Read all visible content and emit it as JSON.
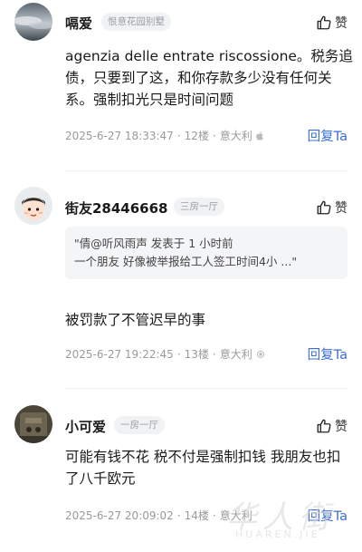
{
  "comments": [
    {
      "username": "嗝爱",
      "tag": "恨意花园别墅",
      "like_label": "赞",
      "text": "agenzia delle entrate riscossione。税务追债，只要到了这，和你存款多少没有任何关系。强制扣光只是时间问题",
      "date": "2025-6-27 18:33:47",
      "floor": "12楼",
      "location": "意大利",
      "reply_label": "回复Ta"
    },
    {
      "username": "街友28446668",
      "tag": "三房一厅",
      "like_label": "赞",
      "quote_line1": "\"倩@听风雨声 发表于 1 小时前",
      "quote_line2": "一个朋友 好像被举报给工人签工时间4小 ...\"",
      "text": "被罚款了不管迟早的事",
      "date": "2025-6-27 19:22:45",
      "floor": "13楼",
      "location": "意大利",
      "reply_label": "回复Ta"
    },
    {
      "username": "小可爱",
      "tag": "一房一厅",
      "like_label": "赞",
      "text": "可能有钱不花 税不付是强制扣钱 我朋友也扣了八千欧元",
      "date": "2025-6-27 20:09:02",
      "floor": "14楼",
      "location": "意大利",
      "reply_label": "回复Ta"
    }
  ],
  "separator": "·",
  "watermark": {
    "cn": "华人街",
    "en": "HUAREN.JIE"
  },
  "colors": {
    "reply": "#3b6fd6",
    "meta": "#9a9a9a",
    "tag_bg": "#f1f2f4"
  }
}
